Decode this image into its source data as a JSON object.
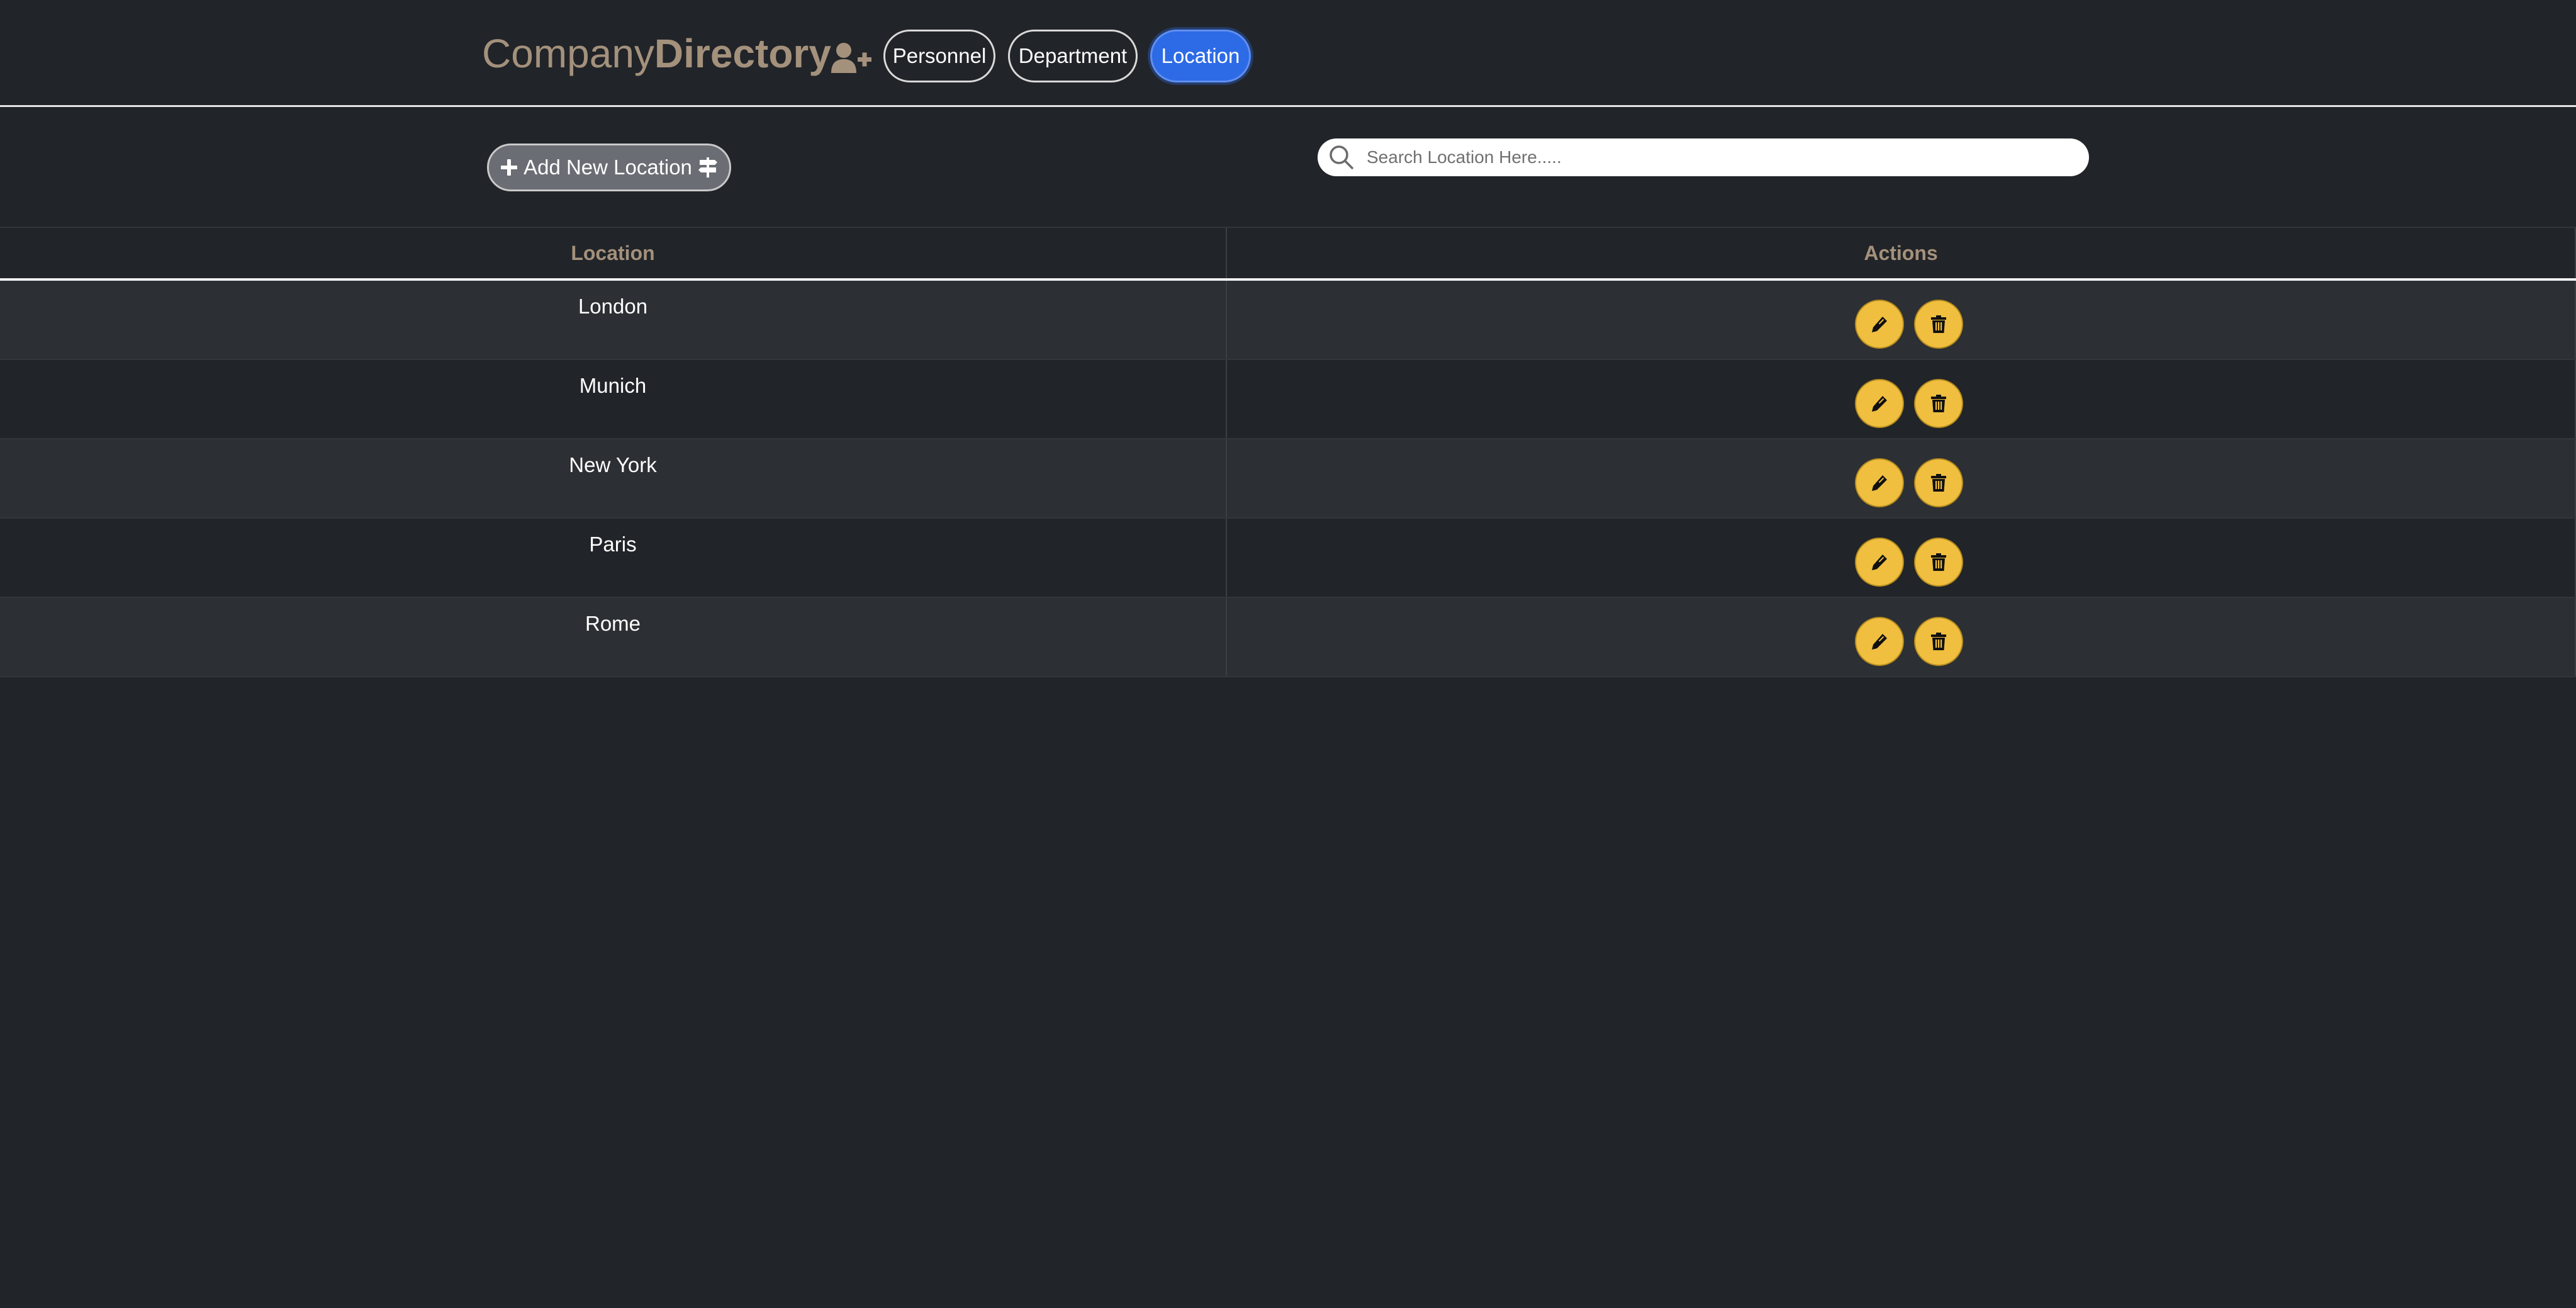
{
  "header": {
    "brand_part1": "Company",
    "brand_part2": "Directory",
    "brand_icon": "user-plus-icon",
    "nav": [
      {
        "label": "Personnel",
        "active": false
      },
      {
        "label": "Department",
        "active": false
      },
      {
        "label": "Location",
        "active": true
      }
    ]
  },
  "toolbar": {
    "add_label": "Add New Location",
    "add_icon_left": "plus-icon",
    "add_icon_right": "signs-post-icon",
    "search_placeholder": "Search Location Here.....",
    "search_icon": "search-icon"
  },
  "table": {
    "columns": [
      "Location",
      "Actions"
    ],
    "rows": [
      {
        "location": "London"
      },
      {
        "location": "Munich"
      },
      {
        "location": "New York"
      },
      {
        "location": "Paris"
      },
      {
        "location": "Rome"
      }
    ],
    "row_actions": [
      "edit-pencil-icon",
      "delete-trash-icon"
    ]
  },
  "colors": {
    "background": "#212428",
    "brand": "#a4917c",
    "active_tab": "#2d6ae6",
    "action_button": "#f0bf3f",
    "striped_row": "#2c2f33"
  }
}
